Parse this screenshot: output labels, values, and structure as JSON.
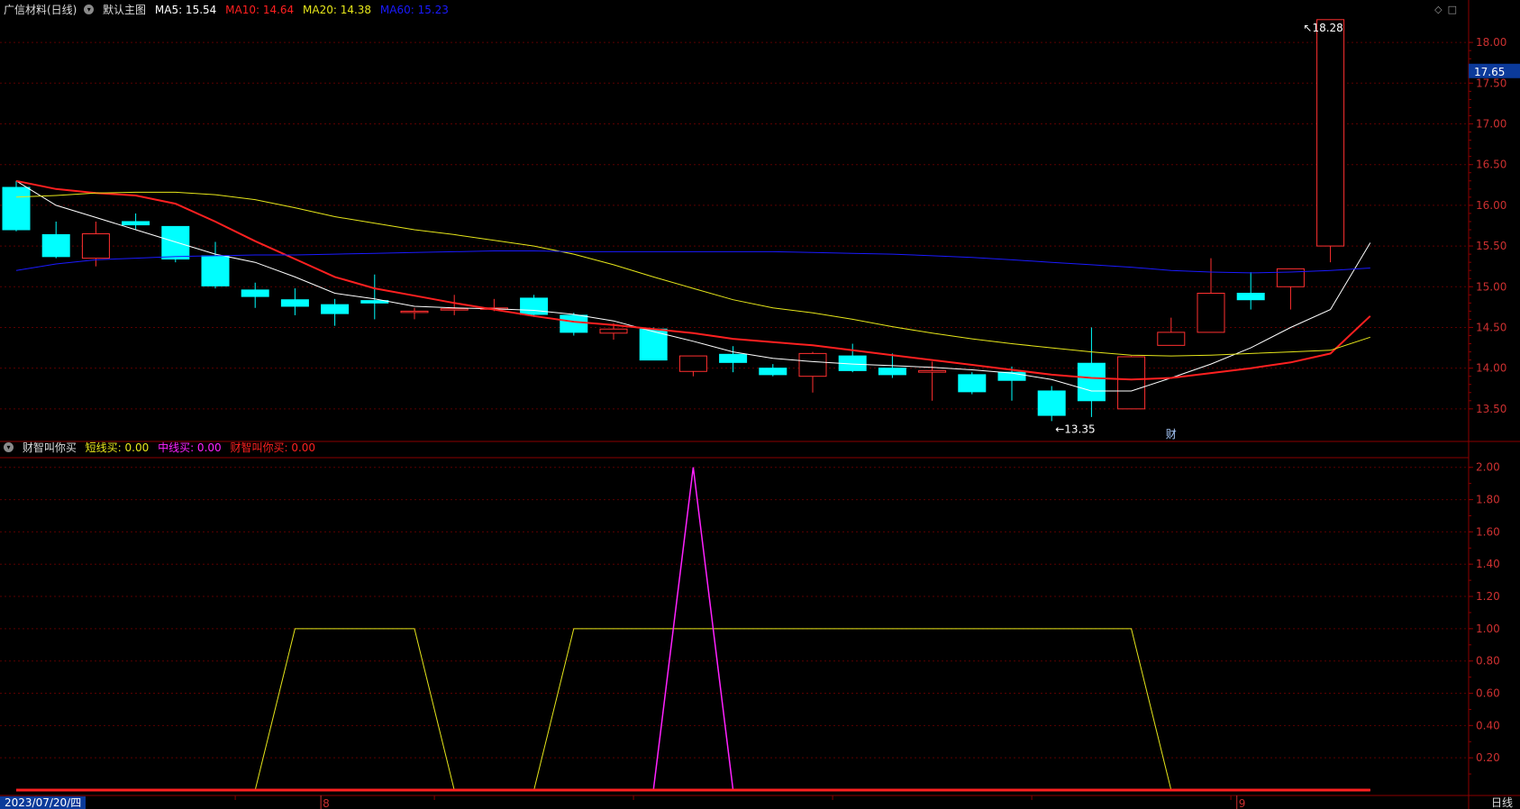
{
  "top_header": {
    "stock_name": "广信材料(日线)",
    "indicator_menu": "默认主图",
    "ma5": {
      "label": "MA5: 15.54",
      "color": "#ffffff"
    },
    "ma10": {
      "label": "MA10: 14.64",
      "color": "#ff2020"
    },
    "ma20": {
      "label": "MA20: 14.38",
      "color": "#e6e61a"
    },
    "ma60": {
      "label": "MA60: 15.23",
      "color": "#1a1aff"
    }
  },
  "bottom_header": {
    "indicator_name": "财智叫你买",
    "short": {
      "label": "短线买: 0.00",
      "color": "#e6e61a"
    },
    "mid": {
      "label": "中线买: 0.00",
      "color": "#ff22ff"
    },
    "main": {
      "label": "财智叫你买: 0.00",
      "color": "#ff2020"
    }
  },
  "date_label": "2023/07/20/四",
  "period_label": "日线",
  "price_badge": "17.65",
  "colors": {
    "up": "#ff3030",
    "down": "#00ffff",
    "grid": "#8b0000",
    "axis": "#8b0000"
  },
  "chart_data": [
    {
      "type": "candlestick",
      "title": "广信材料(日线)",
      "ylim": [
        13.1,
        18.3
      ],
      "y_ticks": [
        "13.50",
        "14.00",
        "14.50",
        "15.00",
        "15.50",
        "16.00",
        "16.50",
        "17.00",
        "17.50",
        "18.00"
      ],
      "x_tick_labels": [
        "8",
        "9"
      ],
      "x_tick_positions": [
        8,
        31
      ],
      "annotations": [
        {
          "text": "18.28",
          "index": 32,
          "value": 18.28
        },
        {
          "text": "13.35",
          "index": 26,
          "value": 13.35
        },
        {
          "text": "财",
          "index": 29,
          "value": 13.35
        }
      ],
      "candles": [
        {
          "o": 16.22,
          "h": 16.3,
          "l": 15.68,
          "c": 15.7
        },
        {
          "o": 15.64,
          "h": 15.8,
          "l": 15.35,
          "c": 15.37
        },
        {
          "o": 15.35,
          "h": 15.8,
          "l": 15.25,
          "c": 15.65
        },
        {
          "o": 15.8,
          "h": 15.9,
          "l": 15.7,
          "c": 15.76
        },
        {
          "o": 15.74,
          "h": 15.74,
          "l": 15.3,
          "c": 15.34
        },
        {
          "o": 15.38,
          "h": 15.55,
          "l": 14.98,
          "c": 15.01
        },
        {
          "o": 14.96,
          "h": 15.05,
          "l": 14.74,
          "c": 14.88
        },
        {
          "o": 14.84,
          "h": 14.98,
          "l": 14.65,
          "c": 14.76
        },
        {
          "o": 14.78,
          "h": 14.85,
          "l": 14.52,
          "c": 14.67
        },
        {
          "o": 14.83,
          "h": 15.15,
          "l": 14.6,
          "c": 14.8
        },
        {
          "o": 14.7,
          "h": 14.74,
          "l": 14.6,
          "c": 14.7
        },
        {
          "o": 14.73,
          "h": 14.9,
          "l": 14.65,
          "c": 14.73
        },
        {
          "o": 14.74,
          "h": 14.85,
          "l": 14.7,
          "c": 14.74
        },
        {
          "o": 14.86,
          "h": 14.9,
          "l": 14.63,
          "c": 14.66
        },
        {
          "o": 14.65,
          "h": 14.68,
          "l": 14.4,
          "c": 14.44
        },
        {
          "o": 14.43,
          "h": 14.55,
          "l": 14.35,
          "c": 14.48
        },
        {
          "o": 14.48,
          "h": 14.5,
          "l": 14.1,
          "c": 14.1
        },
        {
          "o": 13.96,
          "h": 14.15,
          "l": 13.9,
          "c": 14.15
        },
        {
          "o": 14.17,
          "h": 14.27,
          "l": 13.95,
          "c": 14.07
        },
        {
          "o": 14.0,
          "h": 14.05,
          "l": 13.9,
          "c": 13.92
        },
        {
          "o": 13.9,
          "h": 14.2,
          "l": 13.7,
          "c": 14.18
        },
        {
          "o": 14.15,
          "h": 14.3,
          "l": 13.95,
          "c": 13.97
        },
        {
          "o": 14.0,
          "h": 14.18,
          "l": 13.88,
          "c": 13.92
        },
        {
          "o": 13.95,
          "h": 14.08,
          "l": 13.6,
          "c": 13.97
        },
        {
          "o": 13.92,
          "h": 13.95,
          "l": 13.68,
          "c": 13.71
        },
        {
          "o": 13.95,
          "h": 14.02,
          "l": 13.6,
          "c": 13.85
        },
        {
          "o": 13.72,
          "h": 13.78,
          "l": 13.35,
          "c": 13.42
        },
        {
          "o": 14.06,
          "h": 14.5,
          "l": 13.4,
          "c": 13.6
        },
        {
          "o": 13.5,
          "h": 14.15,
          "l": 13.5,
          "c": 14.14
        },
        {
          "o": 14.28,
          "h": 14.62,
          "l": 14.28,
          "c": 14.44
        },
        {
          "o": 14.44,
          "h": 15.35,
          "l": 14.44,
          "c": 14.92
        },
        {
          "o": 14.92,
          "h": 15.18,
          "l": 14.72,
          "c": 14.84
        },
        {
          "o": 15.0,
          "h": 15.22,
          "l": 14.72,
          "c": 15.22
        },
        {
          "o": 15.5,
          "h": 18.28,
          "l": 15.3,
          "c": 18.28
        }
      ],
      "series": [
        {
          "name": "MA5",
          "color": "#ffffff",
          "width": 1,
          "values": [
            16.3,
            16.0,
            15.85,
            15.7,
            15.55,
            15.4,
            15.3,
            15.12,
            14.92,
            14.85,
            14.76,
            14.74,
            14.73,
            14.71,
            14.66,
            14.58,
            14.45,
            14.33,
            14.2,
            14.12,
            14.08,
            14.05,
            14.03,
            14.01,
            13.98,
            13.94,
            13.86,
            13.72,
            13.72,
            13.88,
            14.05,
            14.25,
            14.5,
            14.72,
            15.54
          ]
        },
        {
          "name": "MA10",
          "color": "#ff2020",
          "width": 2,
          "values": [
            16.3,
            16.2,
            16.15,
            16.12,
            16.02,
            15.8,
            15.56,
            15.34,
            15.12,
            14.98,
            14.89,
            14.8,
            14.72,
            14.64,
            14.57,
            14.53,
            14.48,
            14.43,
            14.36,
            14.32,
            14.28,
            14.22,
            14.16,
            14.1,
            14.04,
            13.98,
            13.92,
            13.88,
            13.86,
            13.88,
            13.94,
            14.0,
            14.07,
            14.18,
            14.64
          ]
        },
        {
          "name": "MA20",
          "color": "#e6e61a",
          "width": 1,
          "values": [
            16.1,
            16.12,
            16.15,
            16.16,
            16.16,
            16.13,
            16.07,
            15.97,
            15.86,
            15.78,
            15.7,
            15.64,
            15.57,
            15.5,
            15.4,
            15.27,
            15.12,
            14.98,
            14.84,
            14.74,
            14.68,
            14.6,
            14.51,
            14.43,
            14.36,
            14.3,
            14.25,
            14.2,
            14.16,
            14.15,
            14.16,
            14.18,
            14.2,
            14.22,
            14.38
          ]
        },
        {
          "name": "MA60",
          "color": "#1a1aff",
          "width": 1,
          "values": [
            15.2,
            15.28,
            15.33,
            15.35,
            15.37,
            15.38,
            15.39,
            15.39,
            15.4,
            15.41,
            15.42,
            15.43,
            15.44,
            15.44,
            15.43,
            15.43,
            15.43,
            15.43,
            15.43,
            15.43,
            15.42,
            15.41,
            15.4,
            15.38,
            15.36,
            15.33,
            15.3,
            15.27,
            15.24,
            15.2,
            15.18,
            15.17,
            15.18,
            15.2,
            15.23
          ]
        }
      ]
    },
    {
      "type": "line",
      "title": "财智叫你买",
      "ylim": [
        0,
        2.06
      ],
      "y_ticks": [
        "0.20",
        "0.40",
        "0.60",
        "0.80",
        "1.00",
        "1.20",
        "1.40",
        "1.60",
        "1.80",
        "2.00"
      ],
      "series": [
        {
          "name": "短线买",
          "color": "#e6e61a",
          "width": 1,
          "values": [
            0,
            0,
            0,
            0,
            0,
            0,
            0,
            1,
            1,
            1,
            1,
            0,
            0,
            0,
            1,
            1,
            1,
            1,
            1,
            1,
            1,
            1,
            1,
            1,
            1,
            1,
            1,
            1,
            1,
            0,
            0,
            0,
            0,
            0,
            0
          ]
        },
        {
          "name": "中线买",
          "color": "#ff22ff",
          "width": 1.5,
          "values": [
            0,
            0,
            0,
            0,
            0,
            0,
            0,
            0,
            0,
            0,
            0,
            0,
            0,
            0,
            0,
            0,
            0,
            2,
            0,
            0,
            0,
            0,
            0,
            0,
            0,
            0,
            0,
            0,
            0,
            0,
            0,
            0,
            0,
            0,
            0
          ]
        },
        {
          "name": "财智叫你买",
          "color": "#ff2020",
          "width": 3,
          "values": [
            0,
            0,
            0,
            0,
            0,
            0,
            0,
            0,
            0,
            0,
            0,
            0,
            0,
            0,
            0,
            0,
            0,
            0,
            0,
            0,
            0,
            0,
            0,
            0,
            0,
            0,
            0,
            0,
            0,
            0,
            0,
            0,
            0,
            0,
            0
          ]
        }
      ]
    }
  ]
}
